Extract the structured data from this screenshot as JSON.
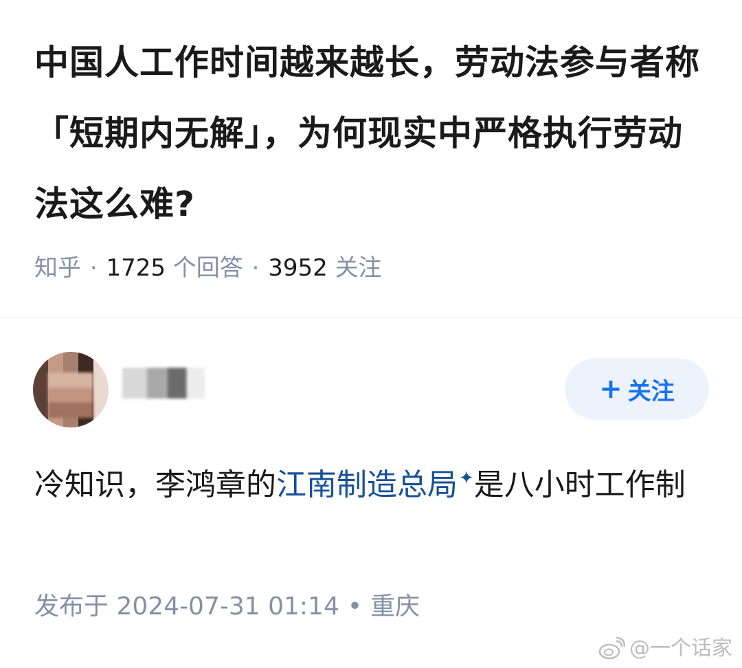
{
  "question": {
    "title": "中国人工作时间越来越长，劳动法参与者称「短期内无解」，为何现实中严格执行劳动法这么难?",
    "source": "知乎",
    "answers_count": "1725",
    "answers_label": "个回答",
    "followers_count": "3952",
    "followers_label": "关注"
  },
  "author": {
    "follow_label": "关注"
  },
  "answer": {
    "text_before": "冷知识，李鸿章的",
    "link_text": "江南制造总局",
    "text_after": "是八小时工作制"
  },
  "post": {
    "published_label": "发布于 2024-07-31 01:14",
    "location": "重庆"
  },
  "watermark": {
    "text": "@一个话家"
  },
  "colors": {
    "accent": "#1772f6",
    "link": "#175199",
    "meta": "#8590a6",
    "button_bg": "#edf3fc"
  }
}
